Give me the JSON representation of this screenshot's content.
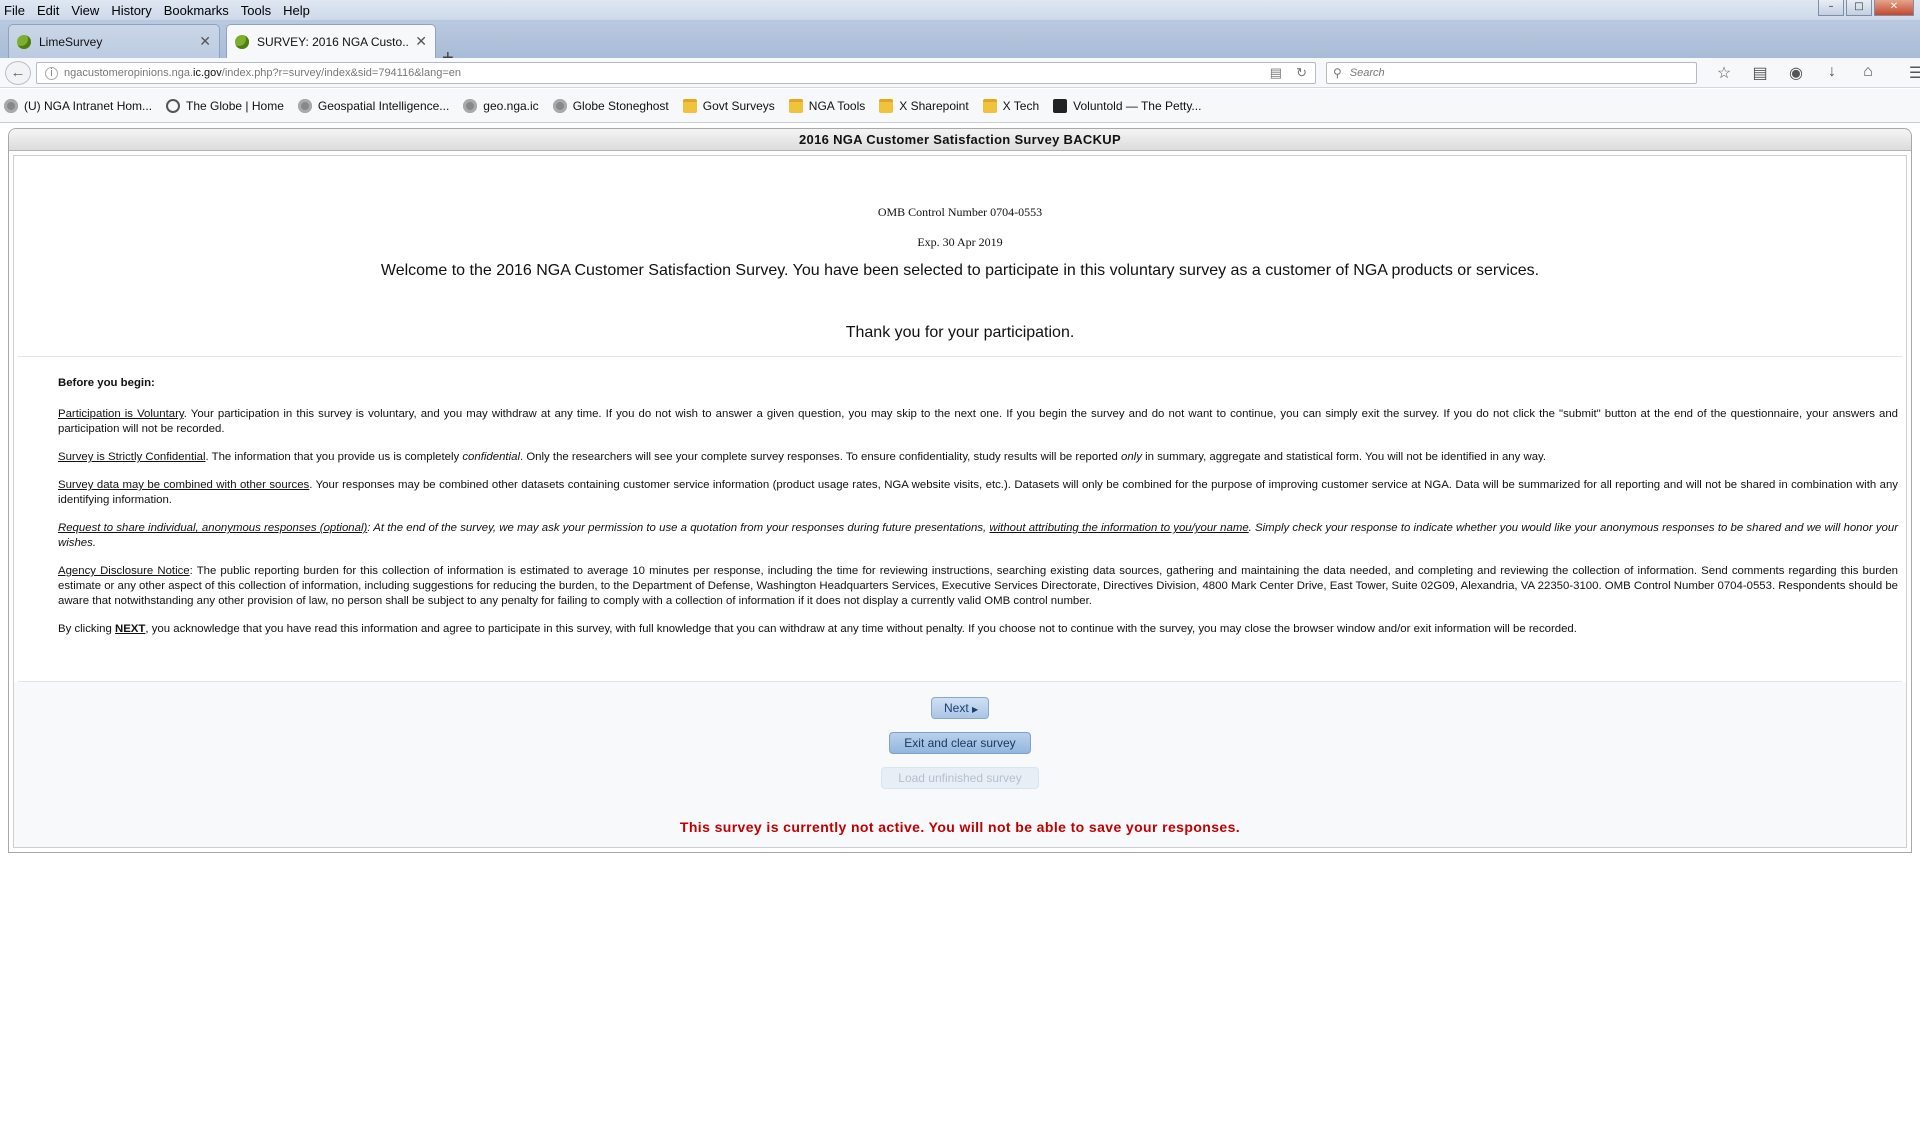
{
  "menubar": {
    "items": [
      "File",
      "Edit",
      "View",
      "History",
      "Bookmarks",
      "Tools",
      "Help"
    ]
  },
  "tabs": [
    {
      "label": "LimeSurvey",
      "active": false
    },
    {
      "label": "SURVEY: 2016 NGA Custo...",
      "active": true
    }
  ],
  "address": {
    "url_prefix": "ngacustomeropinions.nga.",
    "url_domain": "ic.gov",
    "url_suffix": "/index.php?r=survey/index&sid=794116&lang=en"
  },
  "search": {
    "placeholder": "Search"
  },
  "bookmarks": [
    {
      "label": "(U) NGA Intranet Hom...",
      "icon": "globe"
    },
    {
      "label": "The Globe | Home",
      "icon": "g"
    },
    {
      "label": "Geospatial Intelligence...",
      "icon": "globe"
    },
    {
      "label": "geo.nga.ic",
      "icon": "globe"
    },
    {
      "label": "Globe Stoneghost",
      "icon": "globe"
    },
    {
      "label": "Govt Surveys",
      "icon": "folder"
    },
    {
      "label": "NGA Tools",
      "icon": "folder"
    },
    {
      "label": "X Sharepoint",
      "icon": "folder"
    },
    {
      "label": "X Tech",
      "icon": "folder"
    },
    {
      "label": "Voluntold — The Petty...",
      "icon": "dark"
    }
  ],
  "survey": {
    "title": "2016 NGA Customer Satisfaction Survey BACKUP",
    "omb": "OMB Control Number 0704-0553",
    "exp": "Exp. 30 Apr 2019",
    "welcome": "Welcome to the 2016 NGA Customer Satisfaction Survey.  You have been selected to participate in this voluntary survey as a customer of NGA products or services.",
    "thanks": "Thank you for your participation.",
    "before_heading": "Before you begin:",
    "p1_head": "Participation is Voluntary",
    "p1_body": ".  Your participation in this survey is voluntary, and you may withdraw at any time.  If you do not wish to answer a given question, you may skip to the next one.  If you begin the survey and do not want to continue, you can simply exit the survey.  If you do not click the \"submit\" button at the end of the questionnaire, your answers and participation will not be recorded.",
    "p2_head": "Survey is Strictly Confidential",
    "p2_body_a": ".  The information that you provide us is completely ",
    "p2_em1": "confidential",
    "p2_body_b": ". Only the researchers will see your complete survey responses. To ensure confidentiality, study results will be reported ",
    "p2_em2": "only",
    "p2_body_c": " in summary, aggregate and statistical form. You will not be identified in any way.",
    "p3_head": "Survey data may be combined with other sources",
    "p3_body": ". Your responses may be combined other datasets containing customer service information (product usage rates, NGA website visits, etc.). Datasets will only be combined for the purpose of improving customer service at NGA. Data will be summarized for all reporting and will not be shared in combination with any identifying information.",
    "p4_head": "Request to share individual, anonymous responses (optional)",
    "p4_body_a": ": At the end of the survey, we may ask your permission to use a quotation from your responses during future presentations, ",
    "p4_ul": "without attributing the information to you/your name",
    "p4_body_b": ". Simply check your response to indicate whether you would like your anonymous responses to be shared and we will honor your wishes.",
    "p5_head": "Agency Disclosure Notice",
    "p5_body": ": The public reporting burden for this collection of information is estimated to average 10 minutes per response, including the time for reviewing instructions, searching existing data sources, gathering and maintaining the data needed, and completing and reviewing the collection of information. Send comments regarding this burden estimate or any other aspect of this collection of information, including suggestions for reducing the burden, to the Department of Defense, Washington Headquarters Services, Executive Services Directorate, Directives Division, 4800 Mark Center Drive, East Tower, Suite 02G09, Alexandria, VA 22350-3100. OMB Control Number 0704-0553. Respondents should be aware that notwithstanding any other provision of law, no person shall be subject to any penalty for failing to comply with a collection of information if it does not display a currently valid OMB control number.",
    "p6_a": "By clicking ",
    "p6_next": "NEXT",
    "p6_b": ", you acknowledge that you have read this information and agree to participate in this survey, with full knowledge that you can withdraw at any time without penalty. If you choose not to continue with the survey, you may close the browser window and/or exit information will be recorded.",
    "next_label": "Next",
    "exit_label": "Exit and clear survey",
    "load_label": "Load unfinished survey",
    "inactive_msg": "This survey is currently not active. You will not be able to save your responses."
  },
  "colors": {
    "inactive_text": "#c00000",
    "button_blue": "#a9c6e6"
  }
}
